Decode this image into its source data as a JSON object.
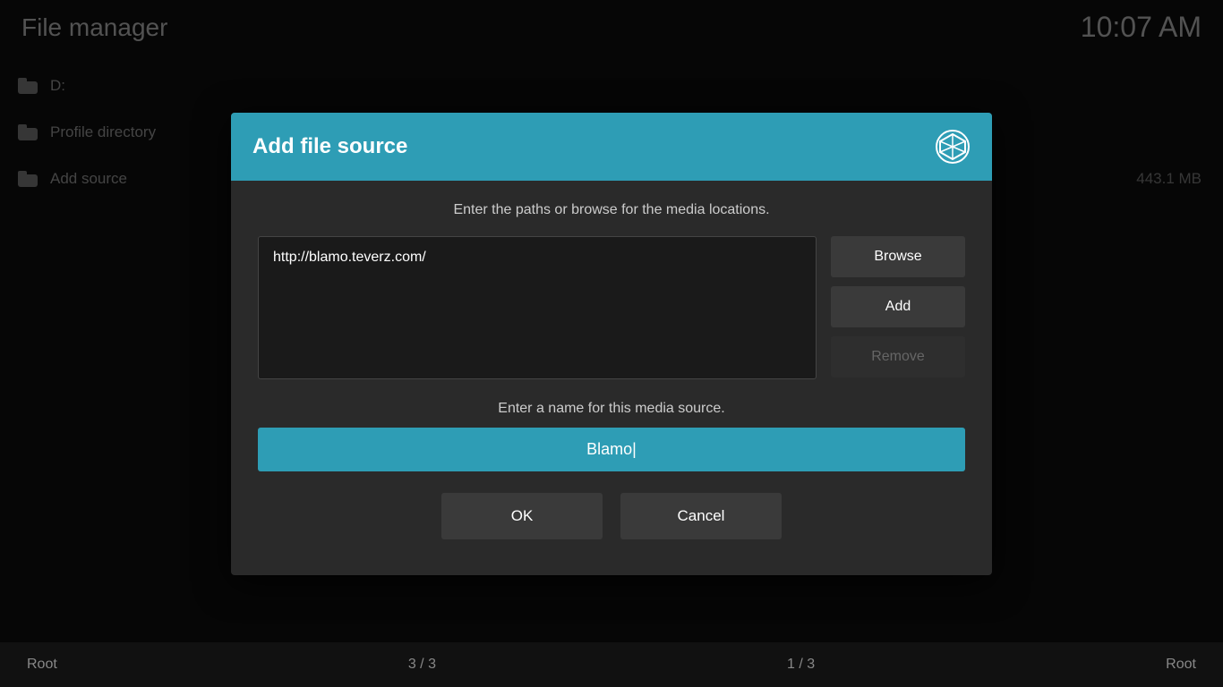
{
  "header": {
    "title": "File manager",
    "time": "10:07 AM"
  },
  "sidebar": {
    "items": [
      {
        "id": "d-drive",
        "label": "D:",
        "icon": "folder-icon"
      },
      {
        "id": "profile-directory",
        "label": "Profile directory",
        "icon": "folder-icon"
      },
      {
        "id": "add-source",
        "label": "Add source",
        "icon": "folder-icon"
      }
    ]
  },
  "right_panel": {
    "size": "443.1 MB"
  },
  "dialog": {
    "title": "Add file source",
    "subtitle": "Enter the paths or browse for the media locations.",
    "path_value": "http://blamo.teverz.com/",
    "buttons": {
      "browse": "Browse",
      "add": "Add",
      "remove": "Remove"
    },
    "name_label": "Enter a name for this media source.",
    "name_value": "Blamo|",
    "ok_label": "OK",
    "cancel_label": "Cancel"
  },
  "footer": {
    "left": "Root",
    "center_left": "3 / 3",
    "center_right": "1 / 3",
    "right": "Root"
  }
}
